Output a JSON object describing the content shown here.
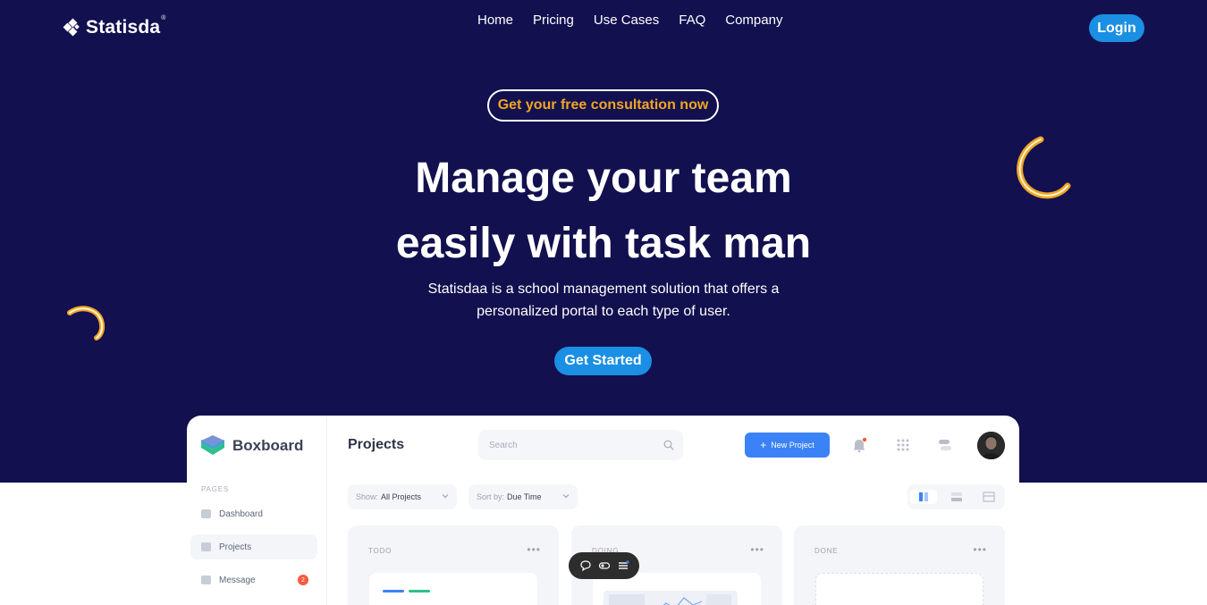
{
  "brand": {
    "name": "Statisda",
    "reg": "®"
  },
  "nav": {
    "items": [
      "Home",
      "Pricing",
      "Use Cases",
      "FAQ",
      "Company"
    ]
  },
  "header": {
    "login_label": "Login"
  },
  "hero": {
    "pill_label": "Get your free consultation now",
    "headline_1": "Manage your team",
    "headline_2": "easily with task man",
    "subline_1": "Statisdaa is a school management solution that offers a",
    "subline_2": "personalized portal to each type of user.",
    "cta_label": "Get Started"
  },
  "colors": {
    "hero_bg": "#12104f",
    "accent_blue": "#1a8fe3",
    "accent_gold": "#f0a623",
    "app_blue": "#3b82f6"
  },
  "dashboard": {
    "brand": "Boxboard",
    "pages_label": "PAGES",
    "sidebar": [
      {
        "label": "Dashboard",
        "icon": "dashboard-icon"
      },
      {
        "label": "Projects",
        "icon": "document-icon"
      },
      {
        "label": "Message",
        "icon": "message-icon",
        "badge": "2"
      }
    ],
    "title": "Projects",
    "search_placeholder": "Search",
    "new_project_label": "New Project",
    "filters": [
      {
        "prefix": "Show:",
        "value": "All Projects"
      },
      {
        "prefix": "Sort by:",
        "value": "Due Time"
      }
    ],
    "columns": [
      {
        "title": "TODO"
      },
      {
        "title": "DOING"
      },
      {
        "title": "DONE"
      }
    ]
  }
}
